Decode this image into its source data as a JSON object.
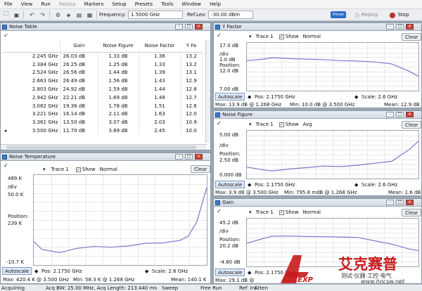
{
  "menu": [
    "File",
    "View",
    "Run",
    "Replay",
    "Markers",
    "Setup",
    "Presets",
    "Tools",
    "Window",
    "Help"
  ],
  "toolbar": {
    "frequency_label": "Frequency:",
    "frequency_value": "1.5000 GHz",
    "ref_label": "Ref.Lev:",
    "ref_value": "-30.00 dBm",
    "preset_label": "Preset",
    "replay_label": "Replay",
    "stop_label": "Stop"
  },
  "noise_table": {
    "title": "Noise Table",
    "check": "✓",
    "columns": [
      "Gain",
      "Noise Figure",
      "Noise Factor",
      "Y Fa"
    ],
    "rows": [
      {
        "freq": "2.245 GHz",
        "gain": "26.03 dB",
        "nf": "1.33 dB",
        "nfac": "1.36",
        "yf": "13.2"
      },
      {
        "freq": "2.384 GHz",
        "gain": "26.25 dB",
        "nf": "1.25 dB",
        "nfac": "1.33",
        "yf": "13.2"
      },
      {
        "freq": "2.524 GHz",
        "gain": "26.56 dB",
        "nf": "1.44 dB",
        "nfac": "1.39",
        "yf": "13.1"
      },
      {
        "freq": "2.663 GHz",
        "gain": "26.49 dB",
        "nf": "1.56 dB",
        "nfac": "1.43",
        "yf": "12.9"
      },
      {
        "freq": "2.803 GHz",
        "gain": "24.92 dB",
        "nf": "1.59 dB",
        "nfac": "1.44",
        "yf": "12.8"
      },
      {
        "freq": "2.942 GHz",
        "gain": "22.21 dB",
        "nf": "1.69 dB",
        "nfac": "1.48",
        "yf": "12.7"
      },
      {
        "freq": "3.082 GHz",
        "gain": "19.36 dB",
        "nf": "1.78 dB",
        "nfac": "1.51",
        "yf": "12.6"
      },
      {
        "freq": "3.221 GHz",
        "gain": "16.14 dB",
        "nf": "2.11 dB",
        "nfac": "1.63",
        "yf": "12.0"
      },
      {
        "freq": "3.361 GHz",
        "gain": "13.50 dB",
        "nf": "3.07 dB",
        "nfac": "2.03",
        "yf": "10.9"
      },
      {
        "freq": "3.500 GHz",
        "gain": "11.70 dB",
        "nf": "3.89 dB",
        "nfac": "2.45",
        "yf": "10.0"
      }
    ]
  },
  "y_factor": {
    "title": "Y Factor",
    "trace": "Trace 1",
    "show": "Show",
    "mode": "Normal",
    "clear": "Clear",
    "top": "17.0 dB",
    "div_label": "/div",
    "div": "1.0 dB",
    "pos_label": "Position:",
    "pos": "12.0 dB",
    "bottom": "7.00 dB",
    "autoscale": "Autoscale",
    "info_pos": "Pos: 2.1750 GHz",
    "info_scale": "Scale: 2.6 GHz",
    "max": "Max: 13.9 dB @ 1.268 GHz",
    "min": "Min: 10.0 dB @ 3.500 GHz",
    "mean": "Mean: 12.9 dB",
    "color": "#7b76c9"
  },
  "noise_figure": {
    "title": "Noise Figure",
    "trace": "Trace 1",
    "show": "Show",
    "mode": "Avg",
    "clear": "Clear",
    "top": "5.00 dB",
    "div_label": "/div",
    "pos_label": "Position:",
    "pos": "2.50 dB",
    "bottom": "0.000 dB",
    "autoscale": "Autoscale",
    "info_pos": "Pos: 2.1750 GHz",
    "info_scale": "Scale: 2.6 GHz",
    "max": "Max: 3.9 dB @ 3.500 GHz",
    "min": "Min: 795.8 mdB @ 1.268 GHz",
    "mean": "Mean: 1.6 dB",
    "color": "#7b76c9"
  },
  "noise_temp": {
    "title": "Noise Temperature",
    "trace": "Trace 1",
    "show": "Show",
    "mode": "Normal",
    "clear": "Clear",
    "top": "489 K",
    "div_label": "/div",
    "div": "50.0 K",
    "pos_label": "Position:",
    "pos": "239 K",
    "bottom": "-10.7 K",
    "autoscale": "Autoscale",
    "info_pos": "Pos: 2.1750 GHz",
    "info_scale": "Scale: 2.6 GHz",
    "max": "Max: 420.4 K @ 3.500 GHz",
    "min": "Min: 58.3 K @ 1.268 GHz",
    "mean": "Mean: 140.1 K",
    "color": "#7b76c9"
  },
  "gain": {
    "title": "Gain",
    "trace": "Trace 1",
    "show": "Show",
    "mode": "Normal",
    "clear": "Clear",
    "top": "45.2 dB",
    "div_label": "/div",
    "pos_label": "Position:",
    "pos": "20.2 dB",
    "bottom": "-4.80 dB",
    "autoscale": "Autoscale",
    "info_pos": "Pos: 2.1750 GHz",
    "max": "Max: 29.1 dB @",
    "color": "#7b76c9"
  },
  "status": {
    "acq": "Acquiring",
    "acq_bw": "Acq BW: 25.00 MHz, Acq Length: 213.440 ms",
    "sweep": "Sweep",
    "free_run": "Free Run",
    "ref": "Ref: Int",
    "atten": "Atten"
  },
  "watermark": {
    "chinese_name": "艾克赛普",
    "sub": "测试·仪器·工控·电气",
    "brand": "ACCEXP",
    "url": "www.hncsw.net"
  },
  "chart_data": [
    {
      "type": "line",
      "name": "Y Factor",
      "unit": "dB",
      "x_range_ghz": [
        0.875,
        3.5
      ],
      "ylim": [
        7,
        17
      ],
      "x": [
        0.875,
        1.13,
        1.268,
        1.53,
        1.79,
        2.05,
        2.31,
        2.57,
        2.83,
        3.09,
        3.35,
        3.5
      ],
      "values": [
        13.3,
        13.6,
        13.9,
        13.7,
        13.6,
        13.5,
        13.3,
        13.2,
        13.0,
        12.6,
        11.1,
        10.0
      ]
    },
    {
      "type": "line",
      "name": "Noise Figure",
      "unit": "dB",
      "x_range_ghz": [
        0.875,
        3.5
      ],
      "ylim": [
        0,
        5
      ],
      "x": [
        0.875,
        1.13,
        1.268,
        1.53,
        1.79,
        2.05,
        2.31,
        2.57,
        2.83,
        3.09,
        3.35,
        3.5
      ],
      "values": [
        1.2,
        0.9,
        0.8,
        1.0,
        1.15,
        1.3,
        1.25,
        1.4,
        1.6,
        1.8,
        3.0,
        3.9
      ]
    },
    {
      "type": "line",
      "name": "Noise Temperature",
      "unit": "K",
      "x_range_ghz": [
        0.875,
        3.5
      ],
      "ylim": [
        -10.7,
        489
      ],
      "x": [
        0.875,
        1.0,
        1.268,
        1.53,
        1.79,
        2.05,
        2.31,
        2.57,
        2.83,
        3.09,
        3.22,
        3.35,
        3.5
      ],
      "values": [
        120,
        75,
        58,
        82,
        92,
        88,
        95,
        110,
        112,
        125,
        150,
        230,
        420
      ]
    },
    {
      "type": "line",
      "name": "Gain",
      "unit": "dB",
      "x_range_ghz": [
        0.875,
        3.5
      ],
      "ylim": [
        -4.8,
        45.2
      ],
      "x": [
        0.875,
        1.13,
        1.268,
        1.53,
        1.79,
        2.05,
        2.31,
        2.57,
        2.83,
        3.09,
        3.35,
        3.5
      ],
      "values": [
        19.5,
        24.5,
        26.8,
        27.0,
        26.5,
        26.3,
        26.0,
        25.5,
        22.0,
        18.5,
        13.5,
        11.7
      ]
    }
  ]
}
